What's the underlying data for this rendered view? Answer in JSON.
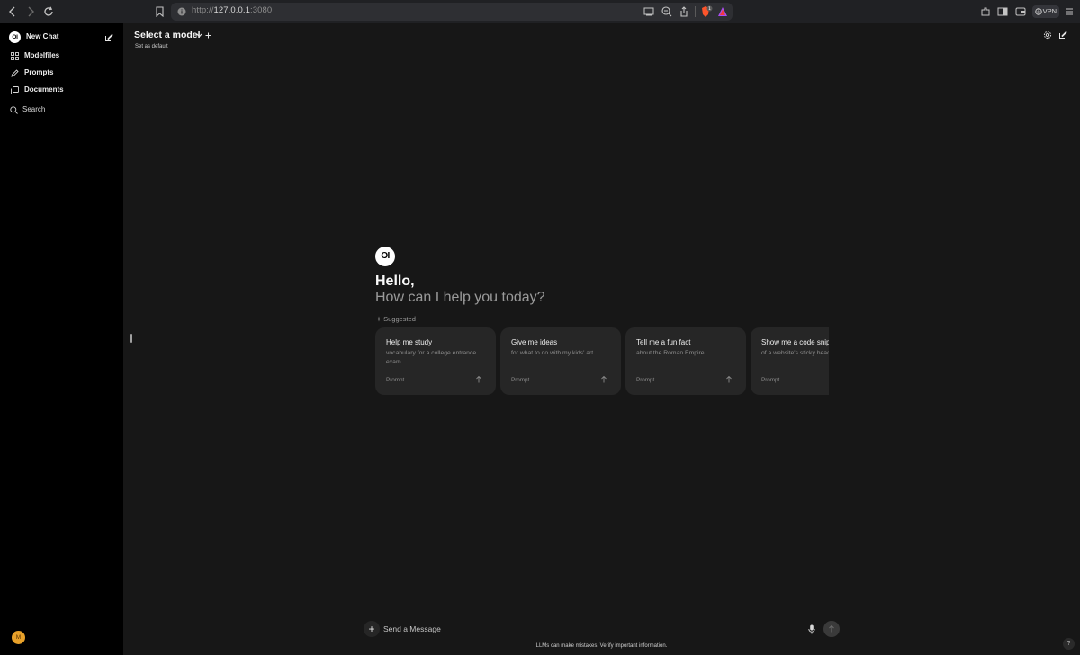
{
  "browser": {
    "url_scheme": "http://",
    "url_host": "127.0.0.1",
    "url_port": ":3080",
    "vpn_label": "VPN",
    "shield_count": "1"
  },
  "sidebar": {
    "brand_logo": "OI",
    "new_chat_label": "New Chat",
    "items": [
      {
        "label": "Modelfiles",
        "icon": "grid-icon"
      },
      {
        "label": "Prompts",
        "icon": "pencil-icon"
      },
      {
        "label": "Documents",
        "icon": "documents-icon"
      }
    ],
    "search_label": "Search",
    "avatar_initial": "M"
  },
  "header": {
    "model_select_label": "Select a model",
    "set_default_label": "Set as default"
  },
  "welcome": {
    "logo": "OI",
    "greeting": "Hello,",
    "subtitle": "How can I help you today?",
    "suggested_label": "Suggested"
  },
  "suggestions": [
    {
      "title": "Help me study",
      "subtitle": "vocabulary for a college entrance exam",
      "kind": "Prompt"
    },
    {
      "title": "Give me ideas",
      "subtitle": "for what to do with my kids' art",
      "kind": "Prompt"
    },
    {
      "title": "Tell me a fun fact",
      "subtitle": "about the Roman Empire",
      "kind": "Prompt"
    },
    {
      "title": "Show me a code snippet",
      "subtitle": "of a website's sticky header",
      "kind": "Prompt"
    }
  ],
  "composer": {
    "placeholder": "Send a Message",
    "disclaimer": "LLMs can make mistakes. Verify important information.",
    "help_label": "?"
  },
  "colors": {
    "background": "#171717",
    "sidebar": "#000000",
    "card": "#262626",
    "avatar": "#e8a12a"
  }
}
